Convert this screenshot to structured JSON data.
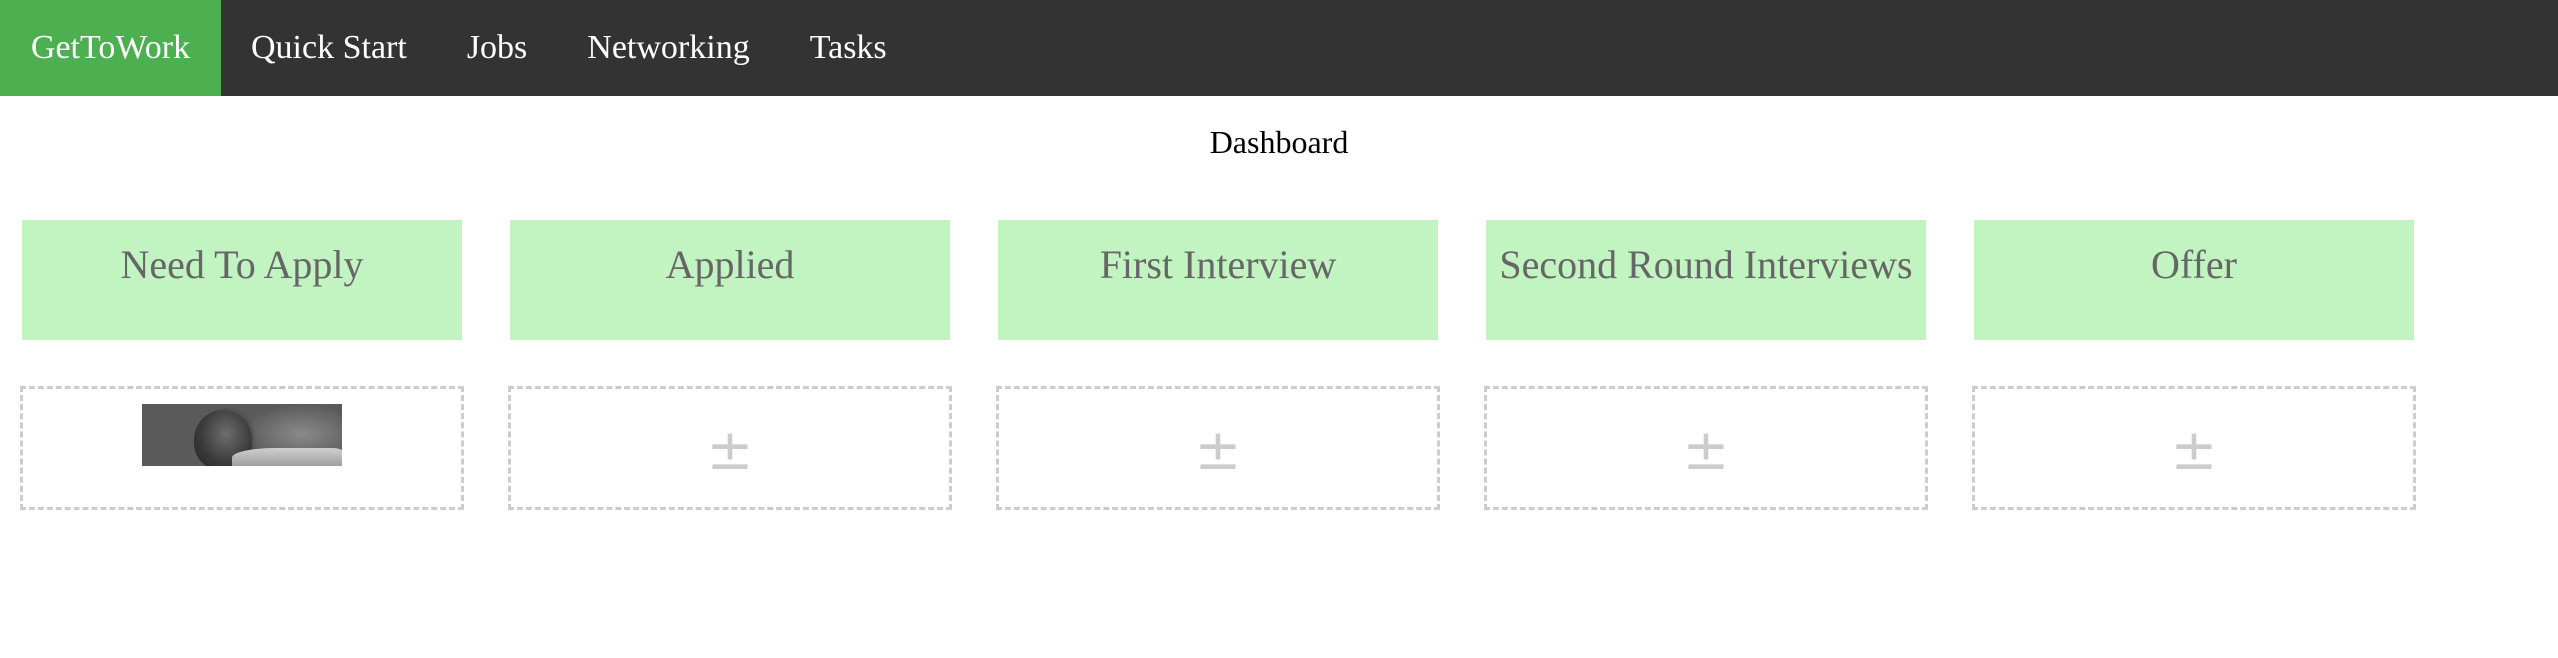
{
  "nav": {
    "brand": "GetToWork",
    "items": [
      {
        "label": "Quick Start"
      },
      {
        "label": "Jobs"
      },
      {
        "label": "Networking"
      },
      {
        "label": "Tasks"
      }
    ]
  },
  "page": {
    "title": "Dashboard"
  },
  "columns": [
    {
      "title": "Need To Apply",
      "has_job_card": true
    },
    {
      "title": "Applied",
      "add_symbol": "±"
    },
    {
      "title": "First Interview",
      "add_symbol": "±"
    },
    {
      "title": "Second Round Interviews",
      "add_symbol": "±"
    },
    {
      "title": "Offer",
      "add_symbol": "±"
    }
  ],
  "colors": {
    "navbar_bg": "#333333",
    "brand_bg": "#4caf50",
    "column_header_bg": "#c1f4c1",
    "column_header_text": "#666666",
    "drop_border": "#cccccc"
  }
}
